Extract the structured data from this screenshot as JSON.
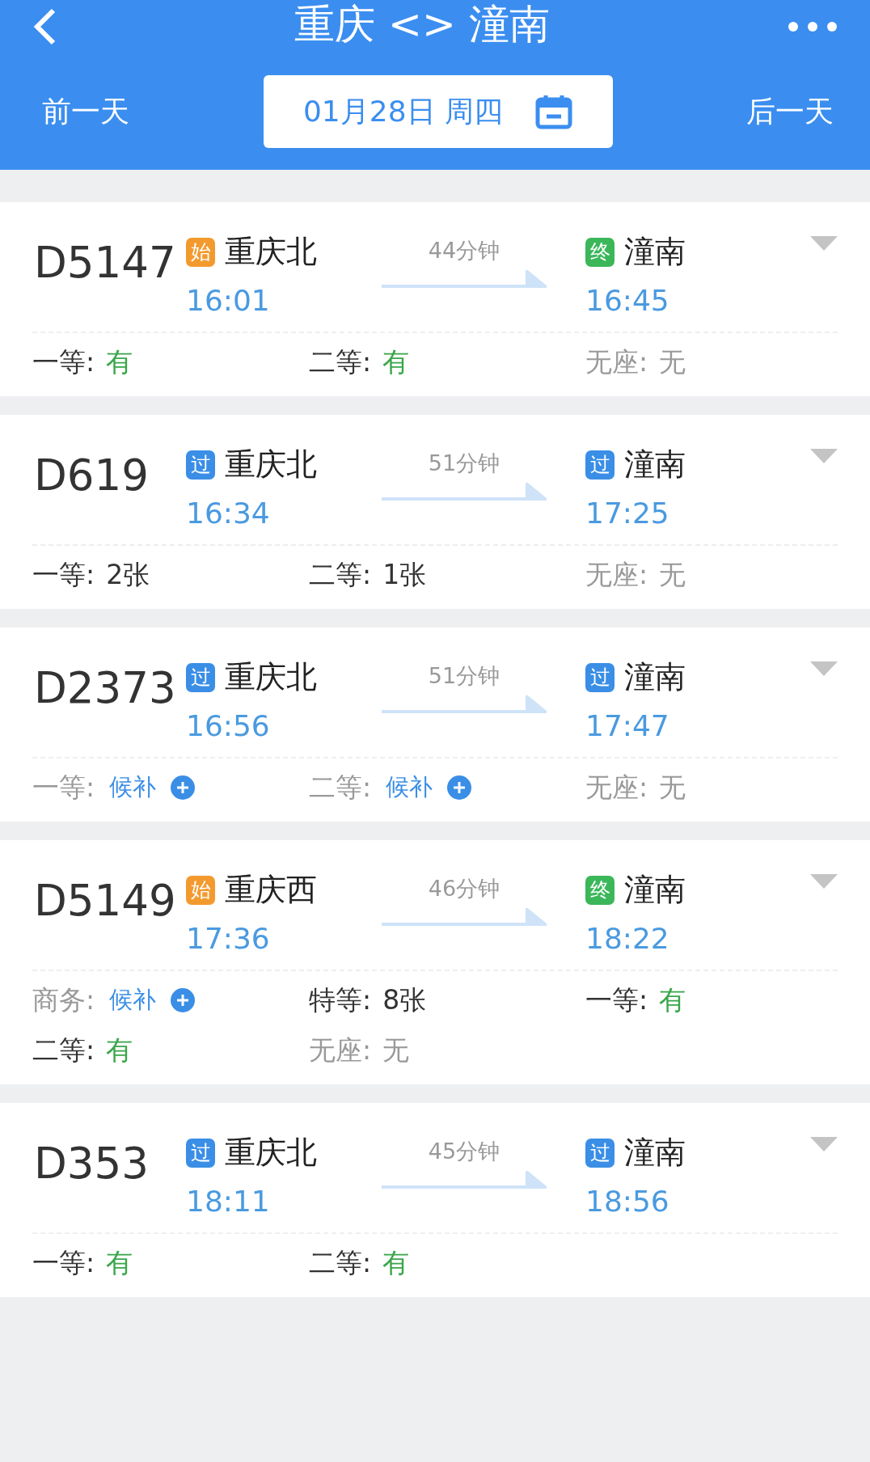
{
  "header": {
    "title": "重庆 <> 潼南",
    "prev_day": "前一天",
    "date": "01月28日 周四",
    "next_day": "后一天"
  },
  "trains": [
    {
      "number": "D5147",
      "from": {
        "badge": "始",
        "color": "#f39a2e",
        "station": "重庆北",
        "time": "16:01"
      },
      "duration": "44分钟",
      "to": {
        "badge": "终",
        "color": "#3bb75a",
        "station": "潼南",
        "time": "16:45"
      },
      "seats": [
        {
          "label": "一等:",
          "value": "有",
          "kind": "available"
        },
        {
          "label": "二等:",
          "value": "有",
          "kind": "available"
        },
        {
          "label": "无座:",
          "value": "无",
          "kind": "none"
        }
      ]
    },
    {
      "number": "D619",
      "from": {
        "badge": "过",
        "color": "#3a8ee6",
        "station": "重庆北",
        "time": "16:34"
      },
      "duration": "51分钟",
      "to": {
        "badge": "过",
        "color": "#3a8ee6",
        "station": "潼南",
        "time": "17:25"
      },
      "seats": [
        {
          "label": "一等:",
          "value": "2张",
          "kind": "count"
        },
        {
          "label": "二等:",
          "value": "1张",
          "kind": "count"
        },
        {
          "label": "无座:",
          "value": "无",
          "kind": "none"
        }
      ]
    },
    {
      "number": "D2373",
      "from": {
        "badge": "过",
        "color": "#3a8ee6",
        "station": "重庆北",
        "time": "16:56"
      },
      "duration": "51分钟",
      "to": {
        "badge": "过",
        "color": "#3a8ee6",
        "station": "潼南",
        "time": "17:47"
      },
      "seats": [
        {
          "label": "一等:",
          "value": "候补",
          "kind": "waitlist"
        },
        {
          "label": "二等:",
          "value": "候补",
          "kind": "waitlist"
        },
        {
          "label": "无座:",
          "value": "无",
          "kind": "none"
        }
      ]
    },
    {
      "number": "D5149",
      "from": {
        "badge": "始",
        "color": "#f39a2e",
        "station": "重庆西",
        "time": "17:36"
      },
      "duration": "46分钟",
      "to": {
        "badge": "终",
        "color": "#3bb75a",
        "station": "潼南",
        "time": "18:22"
      },
      "seats": [
        {
          "label": "商务:",
          "value": "候补",
          "kind": "waitlist"
        },
        {
          "label": "特等:",
          "value": "8张",
          "kind": "count"
        },
        {
          "label": "一等:",
          "value": "有",
          "kind": "available"
        },
        {
          "label": "二等:",
          "value": "有",
          "kind": "available"
        },
        {
          "label": "无座:",
          "value": "无",
          "kind": "none"
        }
      ]
    },
    {
      "number": "D353",
      "from": {
        "badge": "过",
        "color": "#3a8ee6",
        "station": "重庆北",
        "time": "18:11"
      },
      "duration": "45分钟",
      "to": {
        "badge": "过",
        "color": "#3a8ee6",
        "station": "潼南",
        "time": "18:56"
      },
      "seats": [
        {
          "label": "一等:",
          "value": "有",
          "kind": "available"
        },
        {
          "label": "二等:",
          "value": "有",
          "kind": "available"
        }
      ]
    }
  ]
}
